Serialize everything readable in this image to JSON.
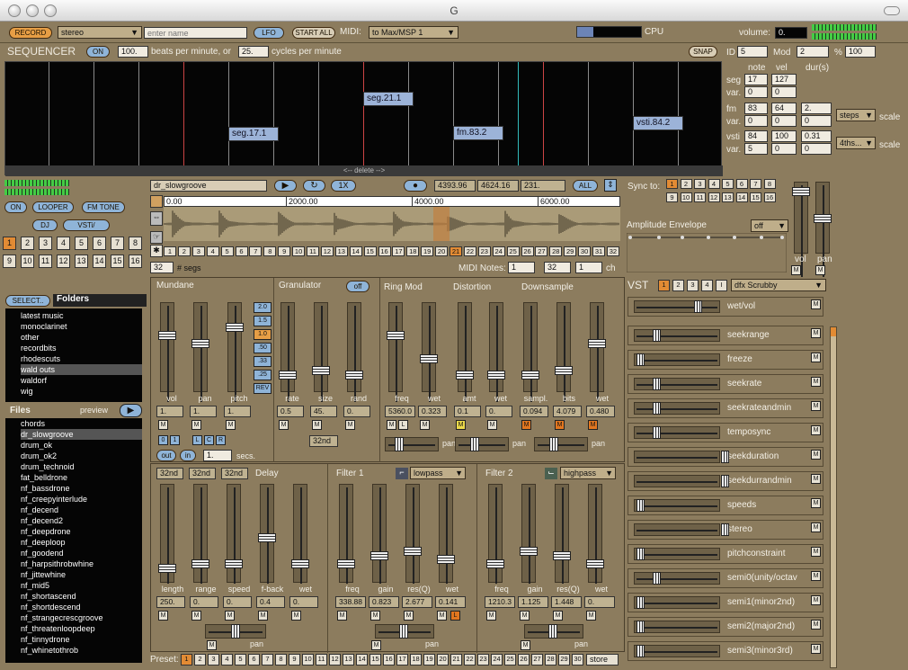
{
  "window": {
    "title": "G"
  },
  "top": {
    "record": "RECORD",
    "stereo": "stereo",
    "name_placeholder": "enter name",
    "lfo": "LFO",
    "start_all": "START ALL",
    "midi_label": "MIDI:",
    "midi_dest": "to Max/MSP 1",
    "cpu": "CPU",
    "volume_label": "volume:",
    "volume": "0."
  },
  "seq": {
    "title": "SEQUENCER",
    "on": "ON",
    "bpm": "100.",
    "bpm_label": "beats per minute, or",
    "cpm": "25.",
    "cpm_label": "cycles per minute",
    "snap": "SNAP",
    "segments": [
      "seg.17.1",
      "seg.21.1",
      "fm.83.2",
      "vsti.84.2"
    ],
    "delete": "<-- delete -->",
    "id_label": "ID",
    "id": "5",
    "mod_label": "Mod",
    "mod": "2",
    "pct_label": "%",
    "pct": "100",
    "col_note": "note",
    "col_vel": "vel",
    "col_dur": "dur(s)",
    "rows": [
      {
        "label": "seg",
        "note": "17",
        "vel": "127",
        "dur": ""
      },
      {
        "label": "var.",
        "note": "0",
        "vel": "0",
        "dur": ""
      },
      {
        "label": "fm",
        "note": "83",
        "vel": "64",
        "dur": "2."
      },
      {
        "label": "var.",
        "note": "0",
        "vel": "0",
        "dur": "0"
      },
      {
        "label": "vsti",
        "note": "84",
        "vel": "100",
        "dur": "0.31"
      },
      {
        "label": "var.",
        "note": "5",
        "vel": "0",
        "dur": "0"
      }
    ],
    "steps": "steps",
    "fourths": "4ths...",
    "scale": "scale"
  },
  "left": {
    "on": "ON",
    "looper": "LOOPER",
    "fmtone": "FM TONE",
    "dj": "DJ",
    "vsti": "VSTi/",
    "grid": [
      "1",
      "2",
      "3",
      "4",
      "5",
      "6",
      "7",
      "8",
      "9",
      "10",
      "11",
      "12",
      "13",
      "14",
      "15",
      "16"
    ],
    "select": "SELECT..",
    "folders_label": "Folders",
    "folders": [
      "latest music",
      "monoclarinet",
      "other",
      "recordbits",
      "rhodescuts",
      "wald outs",
      "waldorf",
      "wig"
    ],
    "files_label": "Files",
    "preview": "preview",
    "files": [
      "chords",
      "dr_slowgroove",
      "drum_ok",
      "drum_ok2",
      "drum_technoid",
      "fat_belldrone",
      "nf_bassdrone",
      "nf_creepyinterlude",
      "nf_decend",
      "nf_decend2",
      "nf_deepdrone",
      "nf_deeploop",
      "nf_goodend",
      "nf_harpsithrobwhine",
      "nf_jittewhine",
      "nf_mid5",
      "nf_shortascend",
      "nf_shortdescend",
      "nf_strangecrescgroove",
      "nf_threatenloopdeep",
      "nf_tinnydrone",
      "nf_whinetothrob"
    ]
  },
  "wave": {
    "file": "dr_slowgroove",
    "x1": "1X",
    "v1": "4393.96",
    "v2": "4624.16",
    "v3": "231.",
    "all": "ALL",
    "ticks": [
      "0.00",
      "2000.00",
      "4000.00",
      "6000.00"
    ],
    "segs": [
      "1",
      "2",
      "3",
      "4",
      "5",
      "6",
      "7",
      "8",
      "9",
      "10",
      "11",
      "12",
      "13",
      "14",
      "15",
      "16",
      "17",
      "18",
      "19",
      "20",
      "21",
      "22",
      "23",
      "24",
      "25",
      "26",
      "27",
      "28",
      "29",
      "30",
      "31",
      "32"
    ],
    "nsegs": "32",
    "nsegs_label": "# segs",
    "midi_notes_label": "MIDI Notes:",
    "mn1": "1",
    "mn2": "32",
    "ch": "1",
    "ch_label": "ch"
  },
  "sync": {
    "label": "Sync to:",
    "nums": [
      "1",
      "2",
      "3",
      "4",
      "5",
      "6",
      "7",
      "8",
      "9",
      "10",
      "11",
      "12",
      "13",
      "14",
      "15",
      "16"
    ],
    "amp_env": "Amplitude Envelope",
    "amp_mode": "off",
    "vol": "vol",
    "pan": "pan"
  },
  "mundane": {
    "title": "Mundane",
    "labels": [
      "vol",
      "pan",
      "pitch"
    ],
    "values": [
      "1.",
      "1.",
      "1."
    ],
    "rates": [
      "2.0",
      "1.5",
      "1.0",
      ".50",
      ".33",
      ".25",
      "REV"
    ],
    "btns": [
      "0",
      "1",
      "L",
      "C",
      "R"
    ],
    "out": "out",
    "in": "in",
    "secs": "1.",
    "secs_label": "secs."
  },
  "gran": {
    "title": "Granulator",
    "off": "off",
    "labels": [
      "rate",
      "size",
      "rand"
    ],
    "values": [
      "0.5",
      "45.",
      "0."
    ],
    "div": "32nd"
  },
  "ring": {
    "title": "Ring Mod",
    "labels": [
      "freq",
      "wet"
    ],
    "values": [
      "5360.0",
      "0.323"
    ],
    "pan": "pan"
  },
  "dist": {
    "title": "Distortion",
    "labels": [
      "amt",
      "wet"
    ],
    "values": [
      "0.1",
      "0."
    ],
    "pan": "pan"
  },
  "down": {
    "title": "Downsample",
    "labels": [
      "sampl.",
      "bits",
      "wet"
    ],
    "values": [
      "0.094",
      "4.079",
      "0.480"
    ],
    "pan": "pan"
  },
  "delay": {
    "title": "Delay",
    "divs": [
      "32nd",
      "32nd",
      "32nd"
    ],
    "labels": [
      "length",
      "range",
      "speed",
      "f-back",
      "wet"
    ],
    "values": [
      "250.",
      "0.",
      "0.",
      "0.4",
      "0."
    ],
    "pan": "pan"
  },
  "f1": {
    "title": "Filter 1",
    "mode": "lowpass",
    "labels": [
      "freq",
      "gain",
      "res(Q)",
      "wet"
    ],
    "values": [
      "338.88",
      "0.823",
      "2.677",
      "0.141"
    ],
    "pan": "pan"
  },
  "f2": {
    "title": "Filter 2",
    "mode": "highpass",
    "labels": [
      "freq",
      "gain",
      "res(Q)",
      "wet"
    ],
    "values": [
      "1210.3",
      "1.125",
      "1.448",
      "0."
    ],
    "pan": "pan"
  },
  "vst": {
    "title": "VST",
    "tabs": [
      "1",
      "2",
      "3",
      "4",
      "I"
    ],
    "plugin": "dfx Scrubby",
    "wetvol": "wet/vol",
    "params": [
      "seekrange",
      "freeze",
      "seekrate",
      "seekrateandmin",
      "temposync",
      "seekduration",
      "seekdurrandmin",
      "speeds",
      "stereo",
      "pitchconstraint",
      "semi0(unity/octav",
      "semi1(minor2nd)",
      "semi2(major2nd)",
      "semi3(minor3rd)"
    ]
  },
  "preset": {
    "label": "Preset:",
    "nums": [
      "1",
      "2",
      "3",
      "4",
      "5",
      "6",
      "7",
      "8",
      "9",
      "10",
      "11",
      "12",
      "13",
      "14",
      "15",
      "16",
      "17",
      "18",
      "19",
      "20",
      "21",
      "22",
      "23",
      "24",
      "25",
      "26",
      "27",
      "28",
      "29",
      "30"
    ],
    "store": "store"
  },
  "m": "M",
  "colors": {
    "bg": "#8c7c5e",
    "orange": "#e28b34",
    "blue": "#9cb3d8"
  }
}
